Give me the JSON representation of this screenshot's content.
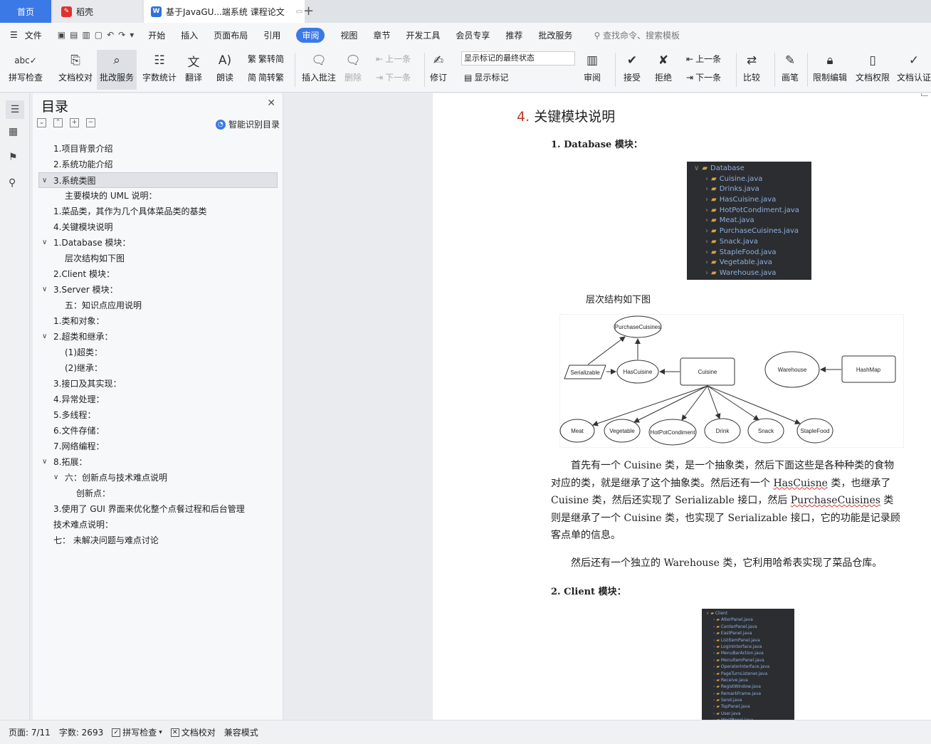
{
  "tabs": {
    "home": "首页",
    "daoke": "稻壳",
    "doc": "基于JavaGU...端系统 课程论文"
  },
  "menu": [
    "文件",
    "开始",
    "插入",
    "页面布局",
    "引用",
    "审阅",
    "视图",
    "章节",
    "开发工具",
    "会员专享",
    "推荐",
    "批改服务"
  ],
  "menu_search": "查找命令、搜索模板",
  "toolbar": {
    "spell": "拼写检查",
    "proof": "文档校对",
    "review_service": "批改服务",
    "wordcount": "字数统计",
    "translate": "翻译",
    "read": "朗读",
    "to_trad": "繁转简",
    "to_simp": "简转繁",
    "insert_comment": "插入批注",
    "delete": "删除",
    "prev": "上一条",
    "next": "下一条",
    "revise": "修订",
    "track_state": "显示标记的最终状态",
    "show_marks": "显示标记",
    "review": "审阅",
    "accept": "接受",
    "reject": "拒绝",
    "prev2": "上一条",
    "next2": "下一条",
    "compare": "比较",
    "pen": "画笔",
    "restrict": "限制编辑",
    "rights": "文档权限",
    "cert": "文档认证"
  },
  "toc": {
    "title": "目录",
    "smart": "智能识别目录",
    "items": [
      "1.项目背景介绍",
      "2.系统功能介绍",
      "3.系统类图",
      "主要模块的 UML 说明：",
      "1.菜品类，其作为几个具体菜品类的基类",
      "4.关键模块说明",
      "1.Database 模块：",
      "层次结构如下图",
      "2.Client 模块：",
      "3.Server 模块：",
      "五：知识点应用说明",
      "1.类和对象：",
      "2.超类和继承：",
      "(1)超类：",
      "(2)继承：",
      "3.接口及其实现：",
      "4.异常处理：",
      "5.多线程：",
      "6.文件存储：",
      "7.网络编程：",
      "8.拓展：",
      "六：创新点与技术难点说明",
      "创新点：",
      "3.使用了 GUI 界面来优化整个点餐过程和后台管理",
      "技术难点说明：",
      "七：  未解决问题与难点讨论"
    ]
  },
  "doc": {
    "h4_num": "4.",
    "h4_text": "关键模块说明",
    "h5_db": "1.  Database 模块：",
    "db_tree": {
      "root": "Database",
      "files": [
        "Cuisine.java",
        "Drinks.java",
        "HasCuisine.java",
        "HotPotCondiment.java",
        "Meat.java",
        "PurchaseCuisines.java",
        "Snack.java",
        "StapleFood.java",
        "Vegetable.java",
        "Warehouse.java"
      ]
    },
    "caption": "层次结构如下图",
    "uml": {
      "purchase": "PurchaseCuisines",
      "serializable": "Serializable",
      "hascuisine": "HasCuisine",
      "cuisine": "Cuisine",
      "warehouse": "Warehouse",
      "hashmap": "HashMap",
      "meat": "Meat",
      "vegetable": "Vegetable",
      "hotpot": "HotPotCondiment",
      "drink": "Drink",
      "snack": "Snack",
      "staple": "StapleFood"
    },
    "para1_a": "首先有一个 Cuisine 类，是一个抽象类，然后下面这些是各种种类的食物对应的类，就是继承了这个抽象类。然后还有一个 ",
    "para1_w1": "HasCuisne",
    "para1_b": " 类，也继承了 Cuisine 类，然后还实现了 Serializable 接口，然后 ",
    "para1_w2": "PurchaseCuisines",
    "para1_c": " 类则是继承了一个 Cuisine 类，也实现了 Serializable 接口，它的功能是记录顾客点单的信息。",
    "para2": "然后还有一个独立的 Warehouse 类，它利用哈希表实现了菜品仓库。",
    "h5_client": "2.  Client 模块：",
    "client_tree": {
      "root": "Client",
      "files": [
        "AlterPanel.java",
        "CenterPanel.java",
        "EastPanel.java",
        "ListItemPanel.java",
        "LoginInterface.java",
        "MenuBarAction.java",
        "MenuItemPanel.java",
        "OperatorInterface.java",
        "PageTurnListener.java",
        "Receive.java",
        "RegistWindow.java",
        "RemarkFrame.java",
        "Send.java",
        "TopPanel.java",
        "User.java",
        "WestPanel.java"
      ]
    }
  },
  "status": {
    "page": "页面: 7/11",
    "words": "字数: 2693",
    "spell": "拼写检查",
    "proof": "文档校对",
    "compat": "兼容模式"
  }
}
